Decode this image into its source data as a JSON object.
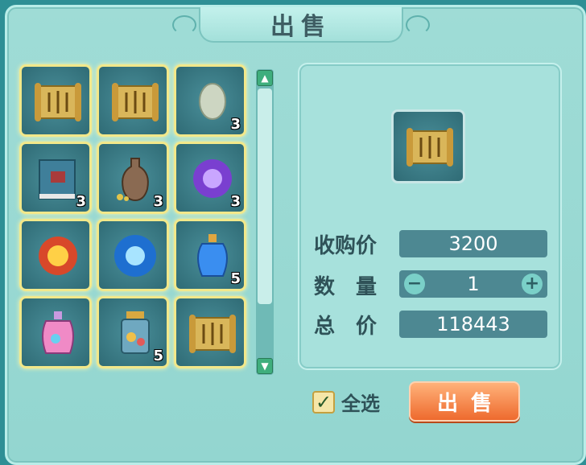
{
  "title": "出售",
  "inventory": [
    {
      "icon": "scroll-icon",
      "count": ""
    },
    {
      "icon": "scroll-icon",
      "count": ""
    },
    {
      "icon": "egg-stone-icon",
      "count": "3"
    },
    {
      "icon": "book-icon",
      "count": "3"
    },
    {
      "icon": "vase-icon",
      "count": "3"
    },
    {
      "icon": "purple-orb-icon",
      "count": "3"
    },
    {
      "icon": "fire-amulet-icon",
      "count": ""
    },
    {
      "icon": "blue-gem-icon",
      "count": ""
    },
    {
      "icon": "blue-potion-icon",
      "count": "5"
    },
    {
      "icon": "rainbow-potion-icon",
      "count": ""
    },
    {
      "icon": "lantern-jar-icon",
      "count": "5"
    },
    {
      "icon": "scroll-icon",
      "count": ""
    }
  ],
  "selected": {
    "icon": "scroll-icon"
  },
  "purchase_price": {
    "label": "收购价",
    "value": "3200"
  },
  "quantity": {
    "label": "数　量",
    "value": "1",
    "minus": "−",
    "plus": "+"
  },
  "total": {
    "label": "总　价",
    "value": "118443"
  },
  "select_all": {
    "label": "全选",
    "checked_glyph": "✓"
  },
  "sell_button": "出售",
  "scroll": {
    "up": "▲",
    "down": "▼"
  },
  "colors": {
    "panel": "#9fdcd6",
    "slot_border": "#f2e88a",
    "sell": "#ee6a2e"
  }
}
